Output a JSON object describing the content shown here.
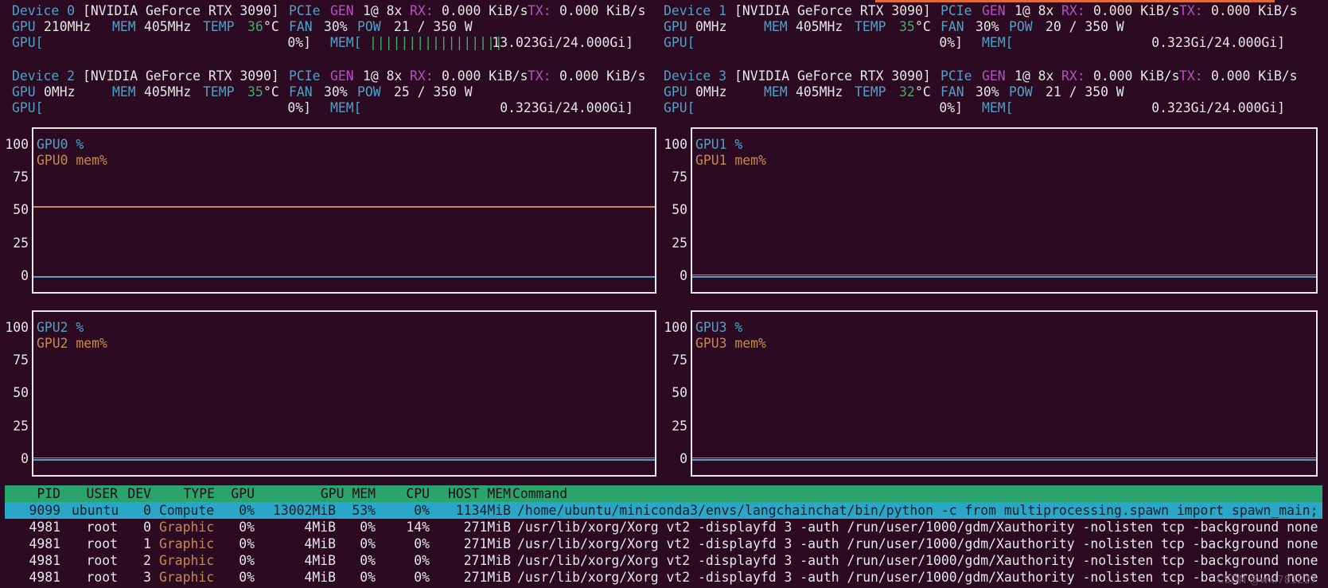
{
  "devices": [
    {
      "id": "Device 0",
      "name": "[NVIDIA GeForce RTX 3090]",
      "pcie": "PCIe",
      "gen": "GEN",
      "gen_val": "1@ 8x",
      "rx_label": "RX:",
      "rx": "0.000 KiB/s",
      "tx_label": "TX:",
      "tx": "0.000 KiB/s",
      "gpu_label": "GPU",
      "gpu_clk": "210MHz",
      "mem_label": "MEM",
      "mem_clk": "405MHz",
      "temp_label": "TEMP",
      "temp": "36",
      "temp_unit": "°C",
      "fan_label": "FAN",
      "fan": "30%",
      "pow_label": "POW",
      "pow": "21 / 350 W",
      "util_label": "GPU[",
      "util": "0%]",
      "mem_bar_label": "MEM[",
      "mem_bar": "|||||||||||||||||",
      "mem_used": "13.023Gi/24.000Gi]"
    },
    {
      "id": "Device 1",
      "name": "[NVIDIA GeForce RTX 3090]",
      "pcie": "PCIe",
      "gen": "GEN",
      "gen_val": "1@ 8x",
      "rx_label": "RX:",
      "rx": "0.000 KiB/s",
      "tx_label": "TX:",
      "tx": "0.000 KiB/s",
      "gpu_label": "GPU",
      "gpu_clk": "0MHz",
      "mem_label": "MEM",
      "mem_clk": "405MHz",
      "temp_label": "TEMP",
      "temp": "35",
      "temp_unit": "°C",
      "fan_label": "FAN",
      "fan": "30%",
      "pow_label": "POW",
      "pow": "20 / 350 W",
      "util_label": "GPU[",
      "util": "0%]",
      "mem_bar_label": "MEM[",
      "mem_bar": "",
      "mem_used": "0.323Gi/24.000Gi]"
    },
    {
      "id": "Device 2",
      "name": "[NVIDIA GeForce RTX 3090]",
      "pcie": "PCIe",
      "gen": "GEN",
      "gen_val": "1@ 8x",
      "rx_label": "RX:",
      "rx": "0.000 KiB/s",
      "tx_label": "TX:",
      "tx": "0.000 KiB/s",
      "gpu_label": "GPU",
      "gpu_clk": "0MHz",
      "mem_label": "MEM",
      "mem_clk": "405MHz",
      "temp_label": "TEMP",
      "temp": "35",
      "temp_unit": "°C",
      "fan_label": "FAN",
      "fan": "30%",
      "pow_label": "POW",
      "pow": "25 / 350 W",
      "util_label": "GPU[",
      "util": "0%]",
      "mem_bar_label": "MEM[",
      "mem_bar": "",
      "mem_used": "0.323Gi/24.000Gi]"
    },
    {
      "id": "Device 3",
      "name": "[NVIDIA GeForce RTX 3090]",
      "pcie": "PCIe",
      "gen": "GEN",
      "gen_val": "1@ 8x",
      "rx_label": "RX:",
      "rx": "0.000 KiB/s",
      "tx_label": "TX:",
      "tx": "0.000 KiB/s",
      "gpu_label": "GPU",
      "gpu_clk": "0MHz",
      "mem_label": "MEM",
      "mem_clk": "405MHz",
      "temp_label": "TEMP",
      "temp": "32",
      "temp_unit": "°C",
      "fan_label": "FAN",
      "fan": "30%",
      "pow_label": "POW",
      "pow": "21 / 350 W",
      "util_label": "GPU[",
      "util": "0%]",
      "mem_bar_label": "MEM[",
      "mem_bar": "",
      "mem_used": "0.323Gi/24.000Gi]"
    }
  ],
  "charts": [
    {
      "util_legend": "GPU0 %",
      "mem_legend": "GPU0 mem%"
    },
    {
      "util_legend": "GPU1 %",
      "mem_legend": "GPU1 mem%"
    },
    {
      "util_legend": "GPU2 %",
      "mem_legend": "GPU2 mem%"
    },
    {
      "util_legend": "GPU3 %",
      "mem_legend": "GPU3 mem%"
    }
  ],
  "y_ticks": [
    "100",
    "75",
    "50",
    "25",
    "0"
  ],
  "colors": {
    "util": "#4aa3c8",
    "mem": "#c88a4a",
    "background": "#2c0a22",
    "header": "#2aa36c",
    "selected": "#2aa6c8"
  },
  "chart_data": [
    {
      "type": "line",
      "ylim": [
        0,
        100
      ],
      "series": [
        {
          "name": "GPU0 %",
          "values": [
            0,
            0
          ]
        },
        {
          "name": "GPU0 mem%",
          "values": [
            53,
            53
          ]
        }
      ]
    },
    {
      "type": "line",
      "ylim": [
        0,
        100
      ],
      "series": [
        {
          "name": "GPU1 %",
          "values": [
            0,
            0
          ]
        },
        {
          "name": "GPU1 mem%",
          "values": [
            1,
            1
          ]
        }
      ]
    },
    {
      "type": "line",
      "ylim": [
        0,
        100
      ],
      "series": [
        {
          "name": "GPU2 %",
          "values": [
            0,
            0
          ]
        },
        {
          "name": "GPU2 mem%",
          "values": [
            1,
            1
          ]
        }
      ]
    },
    {
      "type": "line",
      "ylim": [
        0,
        100
      ],
      "series": [
        {
          "name": "GPU3 %",
          "values": [
            0,
            0
          ]
        },
        {
          "name": "GPU3 mem%",
          "values": [
            1,
            1
          ]
        }
      ]
    }
  ],
  "process_table": {
    "headers": {
      "pid": "PID",
      "user": "USER",
      "dev": "DEV",
      "type": "TYPE",
      "gpu": "GPU",
      "gpu_mem": "GPU MEM",
      "cpu": "CPU",
      "host_mem": "HOST MEM",
      "command": "Command"
    },
    "rows": [
      {
        "pid": "9099",
        "user": "ubuntu",
        "dev": "0",
        "type": "Compute",
        "gpu": "0%",
        "gpu_mem": "13002MiB",
        "gpu_mem_pct": "53%",
        "cpu": "0%",
        "host_mem": "1134MiB",
        "command": "/home/ubuntu/miniconda3/envs/langchainchat/bin/python -c from multiprocessing.spawn import spawn_main;"
      },
      {
        "pid": "4981",
        "user": "root",
        "dev": "0",
        "type": "Graphic",
        "gpu": "0%",
        "gpu_mem": "4MiB",
        "gpu_mem_pct": "0%",
        "cpu": "14%",
        "host_mem": "271MiB",
        "command": "/usr/lib/xorg/Xorg vt2 -displayfd 3 -auth /run/user/1000/gdm/Xauthority -nolisten tcp -background none"
      },
      {
        "pid": "4981",
        "user": "root",
        "dev": "1",
        "type": "Graphic",
        "gpu": "0%",
        "gpu_mem": "4MiB",
        "gpu_mem_pct": "0%",
        "cpu": "0%",
        "host_mem": "271MiB",
        "command": "/usr/lib/xorg/Xorg vt2 -displayfd 3 -auth /run/user/1000/gdm/Xauthority -nolisten tcp -background none"
      },
      {
        "pid": "4981",
        "user": "root",
        "dev": "2",
        "type": "Graphic",
        "gpu": "0%",
        "gpu_mem": "4MiB",
        "gpu_mem_pct": "0%",
        "cpu": "0%",
        "host_mem": "271MiB",
        "command": "/usr/lib/xorg/Xorg vt2 -displayfd 3 -auth /run/user/1000/gdm/Xauthority -nolisten tcp -background none"
      },
      {
        "pid": "4981",
        "user": "root",
        "dev": "3",
        "type": "Graphic",
        "gpu": "0%",
        "gpu_mem": "4MiB",
        "gpu_mem_pct": "0%",
        "cpu": "0%",
        "host_mem": "271MiB",
        "command": "/usr/lib/xorg/Xorg vt2 -displayfd 3 -auth /run/user/1000/gdm/Xauthority -nolisten tcp -background none"
      }
    ]
  },
  "watermark": "CSDN @wxl781227"
}
